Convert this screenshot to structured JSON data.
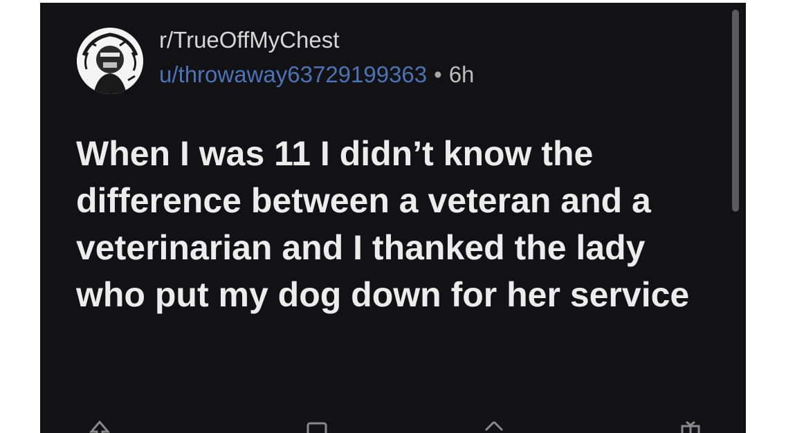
{
  "post": {
    "subreddit": "r/TrueOffMyChest",
    "username": "u/throwaway63729199363",
    "separator": "•",
    "age": "6h",
    "title": "When I was 11 I didn’t know the difference between a veteran and a veterinarian and I thanked the lady who put my dog down for her service"
  },
  "actions": [
    {
      "icon": "upvote-icon"
    },
    {
      "icon": "comment-icon"
    },
    {
      "icon": "share-icon"
    },
    {
      "icon": "award-icon"
    }
  ],
  "colors": {
    "background": "#121214",
    "username": "#4a73b8",
    "text": "#ececec"
  }
}
